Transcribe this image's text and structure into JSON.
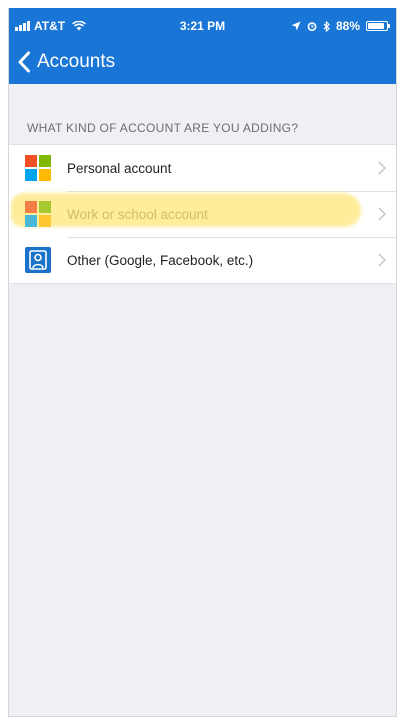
{
  "status_bar": {
    "carrier": "AT&T",
    "time": "3:21 PM",
    "battery_percent": "88%",
    "battery_level": 0.88,
    "icons": [
      "signal-icon",
      "wifi-icon",
      "location-icon",
      "alarm-icon",
      "bluetooth-icon",
      "battery-icon"
    ]
  },
  "nav": {
    "back_label": "Accounts",
    "back_icon": "chevron-left-icon"
  },
  "section": {
    "header": "WHAT KIND OF ACCOUNT ARE YOU ADDING?"
  },
  "account_types": [
    {
      "label": "Personal account",
      "icon": "microsoft-logo-icon"
    },
    {
      "label": "Work or school account",
      "icon": "microsoft-logo-icon",
      "highlighted": true
    },
    {
      "label": "Other (Google, Facebook, etc.)",
      "icon": "person-badge-icon"
    }
  ],
  "colors": {
    "header_blue": "#1976d6",
    "ms_red": "#f25022",
    "ms_green": "#7fba00",
    "ms_blue": "#00a4ef",
    "ms_yellow": "#ffb900",
    "highlight": "#ffe15a",
    "other_icon_blue": "#1a73c9"
  }
}
